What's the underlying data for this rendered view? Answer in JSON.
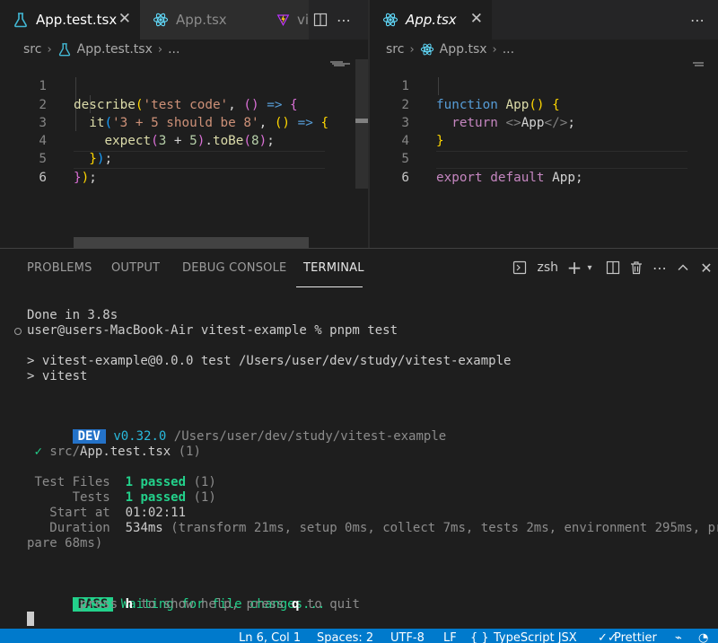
{
  "colors": {
    "accent": "#007acc",
    "react_icon": "#61dafb",
    "test_icon": "#42b8d4",
    "pass_green": "#23d18b",
    "dev_blue": "#2472c8"
  },
  "left_editor": {
    "tabs": [
      {
        "label": "App.test.tsx",
        "icon": "test-beaker-icon",
        "active": true
      },
      {
        "label": "App.tsx",
        "icon": "react-icon",
        "active": false
      },
      {
        "label": "vi",
        "icon": "vite-icon",
        "active": false
      }
    ],
    "breadcrumb": {
      "folder": "src",
      "file": "App.test.tsx",
      "more": "..."
    },
    "lines": [
      "1",
      "2",
      "3",
      "4",
      "5",
      "6"
    ]
  },
  "right_editor": {
    "tabs": [
      {
        "label": "App.tsx",
        "icon": "react-icon",
        "active": true
      }
    ],
    "breadcrumb": {
      "folder": "src",
      "file": "App.tsx",
      "more": "..."
    },
    "lines": [
      "1",
      "2",
      "3",
      "4",
      "5",
      "6"
    ]
  },
  "panel": {
    "tabs": [
      "PROBLEMS",
      "OUTPUT",
      "DEBUG CONSOLE",
      "TERMINAL"
    ],
    "active_tab": "TERMINAL",
    "shell": "zsh"
  },
  "terminal": {
    "done": "Done in 3.8s",
    "prompt": "user@users-MacBook-Air vitest-example % pnpm test",
    "run1": "> vitest-example@0.0.0 test /Users/user/dev/study/vitest-example",
    "run2": "> vitest",
    "dev_badge": "DEV",
    "version": "v0.32.0",
    "dev_path": "/Users/user/dev/study/vitest-example",
    "check": "✓",
    "file_dir": "src/",
    "file_name": "App.test.tsx",
    "file_count": "(1)",
    "files_label": "Test Files",
    "files_passed": "1 passed",
    "files_count": "(1)",
    "tests_label": "Tests",
    "tests_passed": "1 passed",
    "tests_count": "(1)",
    "start_label": "Start at",
    "start_value": "01:02:11",
    "duration_label": "Duration",
    "duration_value": "534ms",
    "duration_detail": "(transform 21ms, setup 0ms, collect 7ms, tests 2ms, environment 295ms, pre",
    "duration_wrap": "pare 68ms)",
    "pass_badge": "PASS",
    "waiting": "Waiting for file changes...",
    "help_pre": "press ",
    "help_h": "h",
    "help_mid": " to show help, press ",
    "help_q": "q",
    "help_post": " to quit"
  },
  "statusbar": {
    "position": "Ln 6, Col 1",
    "spaces": "Spaces: 2",
    "encoding": "UTF-8",
    "eol": "LF",
    "language": "TypeScript JSX",
    "formatter": "Prettier"
  }
}
